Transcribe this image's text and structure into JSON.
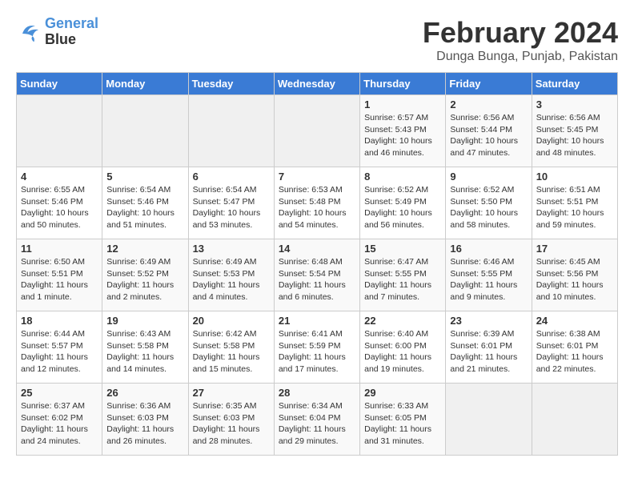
{
  "header": {
    "logo_line1": "General",
    "logo_line2": "Blue",
    "title": "February 2024",
    "subtitle": "Dunga Bunga, Punjab, Pakistan"
  },
  "days_of_week": [
    "Sunday",
    "Monday",
    "Tuesday",
    "Wednesday",
    "Thursday",
    "Friday",
    "Saturday"
  ],
  "weeks": [
    [
      {
        "day": "",
        "info": ""
      },
      {
        "day": "",
        "info": ""
      },
      {
        "day": "",
        "info": ""
      },
      {
        "day": "",
        "info": ""
      },
      {
        "day": "1",
        "info": "Sunrise: 6:57 AM\nSunset: 5:43 PM\nDaylight: 10 hours\nand 46 minutes."
      },
      {
        "day": "2",
        "info": "Sunrise: 6:56 AM\nSunset: 5:44 PM\nDaylight: 10 hours\nand 47 minutes."
      },
      {
        "day": "3",
        "info": "Sunrise: 6:56 AM\nSunset: 5:45 PM\nDaylight: 10 hours\nand 48 minutes."
      }
    ],
    [
      {
        "day": "4",
        "info": "Sunrise: 6:55 AM\nSunset: 5:46 PM\nDaylight: 10 hours\nand 50 minutes."
      },
      {
        "day": "5",
        "info": "Sunrise: 6:54 AM\nSunset: 5:46 PM\nDaylight: 10 hours\nand 51 minutes."
      },
      {
        "day": "6",
        "info": "Sunrise: 6:54 AM\nSunset: 5:47 PM\nDaylight: 10 hours\nand 53 minutes."
      },
      {
        "day": "7",
        "info": "Sunrise: 6:53 AM\nSunset: 5:48 PM\nDaylight: 10 hours\nand 54 minutes."
      },
      {
        "day": "8",
        "info": "Sunrise: 6:52 AM\nSunset: 5:49 PM\nDaylight: 10 hours\nand 56 minutes."
      },
      {
        "day": "9",
        "info": "Sunrise: 6:52 AM\nSunset: 5:50 PM\nDaylight: 10 hours\nand 58 minutes."
      },
      {
        "day": "10",
        "info": "Sunrise: 6:51 AM\nSunset: 5:51 PM\nDaylight: 10 hours\nand 59 minutes."
      }
    ],
    [
      {
        "day": "11",
        "info": "Sunrise: 6:50 AM\nSunset: 5:51 PM\nDaylight: 11 hours\nand 1 minute."
      },
      {
        "day": "12",
        "info": "Sunrise: 6:49 AM\nSunset: 5:52 PM\nDaylight: 11 hours\nand 2 minutes."
      },
      {
        "day": "13",
        "info": "Sunrise: 6:49 AM\nSunset: 5:53 PM\nDaylight: 11 hours\nand 4 minutes."
      },
      {
        "day": "14",
        "info": "Sunrise: 6:48 AM\nSunset: 5:54 PM\nDaylight: 11 hours\nand 6 minutes."
      },
      {
        "day": "15",
        "info": "Sunrise: 6:47 AM\nSunset: 5:55 PM\nDaylight: 11 hours\nand 7 minutes."
      },
      {
        "day": "16",
        "info": "Sunrise: 6:46 AM\nSunset: 5:55 PM\nDaylight: 11 hours\nand 9 minutes."
      },
      {
        "day": "17",
        "info": "Sunrise: 6:45 AM\nSunset: 5:56 PM\nDaylight: 11 hours\nand 10 minutes."
      }
    ],
    [
      {
        "day": "18",
        "info": "Sunrise: 6:44 AM\nSunset: 5:57 PM\nDaylight: 11 hours\nand 12 minutes."
      },
      {
        "day": "19",
        "info": "Sunrise: 6:43 AM\nSunset: 5:58 PM\nDaylight: 11 hours\nand 14 minutes."
      },
      {
        "day": "20",
        "info": "Sunrise: 6:42 AM\nSunset: 5:58 PM\nDaylight: 11 hours\nand 15 minutes."
      },
      {
        "day": "21",
        "info": "Sunrise: 6:41 AM\nSunset: 5:59 PM\nDaylight: 11 hours\nand 17 minutes."
      },
      {
        "day": "22",
        "info": "Sunrise: 6:40 AM\nSunset: 6:00 PM\nDaylight: 11 hours\nand 19 minutes."
      },
      {
        "day": "23",
        "info": "Sunrise: 6:39 AM\nSunset: 6:01 PM\nDaylight: 11 hours\nand 21 minutes."
      },
      {
        "day": "24",
        "info": "Sunrise: 6:38 AM\nSunset: 6:01 PM\nDaylight: 11 hours\nand 22 minutes."
      }
    ],
    [
      {
        "day": "25",
        "info": "Sunrise: 6:37 AM\nSunset: 6:02 PM\nDaylight: 11 hours\nand 24 minutes."
      },
      {
        "day": "26",
        "info": "Sunrise: 6:36 AM\nSunset: 6:03 PM\nDaylight: 11 hours\nand 26 minutes."
      },
      {
        "day": "27",
        "info": "Sunrise: 6:35 AM\nSunset: 6:03 PM\nDaylight: 11 hours\nand 28 minutes."
      },
      {
        "day": "28",
        "info": "Sunrise: 6:34 AM\nSunset: 6:04 PM\nDaylight: 11 hours\nand 29 minutes."
      },
      {
        "day": "29",
        "info": "Sunrise: 6:33 AM\nSunset: 6:05 PM\nDaylight: 11 hours\nand 31 minutes."
      },
      {
        "day": "",
        "info": ""
      },
      {
        "day": "",
        "info": ""
      }
    ]
  ]
}
